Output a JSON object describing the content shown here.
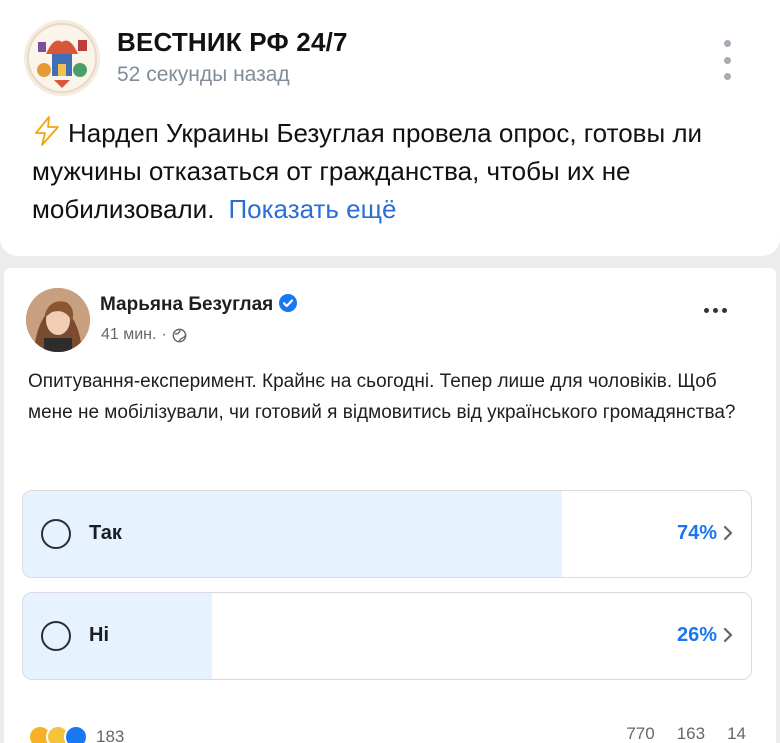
{
  "vk_post": {
    "title": "ВЕСТНИК РФ 24/7",
    "time": "52 секунды назад",
    "text": "Нардеп Украины Безуглая провела опрос, готовы ли мужчины отказаться от гражданства, чтобы их не мобилизовали.",
    "more_link": "Показать ещё"
  },
  "fb_post": {
    "author": "Марьяна Безуглая",
    "time": "41 мин.",
    "separator": "·",
    "text": "Опитування-експеримент. Крайнє на сьогодні. Тепер лише для чоловіків. Щоб мене не мобілізували, чи готовий я відмовитись від українського громадянства?",
    "poll": [
      {
        "label": "Так",
        "percent_text": "74%",
        "percent": 74
      },
      {
        "label": "Ні",
        "percent_text": "26%",
        "percent": 26
      }
    ],
    "reactions_count": "183",
    "stats": [
      "770",
      "163",
      "14"
    ]
  },
  "colors": {
    "link_blue": "#2a6fd6",
    "fb_blue": "#1877f2",
    "poll_fill": "#e6f2fd",
    "muted": "#818c99"
  },
  "icons": {
    "vk_menu": "vertical-dots-icon",
    "bolt": "lightning-bolt-icon",
    "verified": "verified-badge-icon",
    "globe": "globe-icon",
    "fb_menu": "horizontal-dots-icon",
    "chevron": "chevron-right-icon"
  }
}
